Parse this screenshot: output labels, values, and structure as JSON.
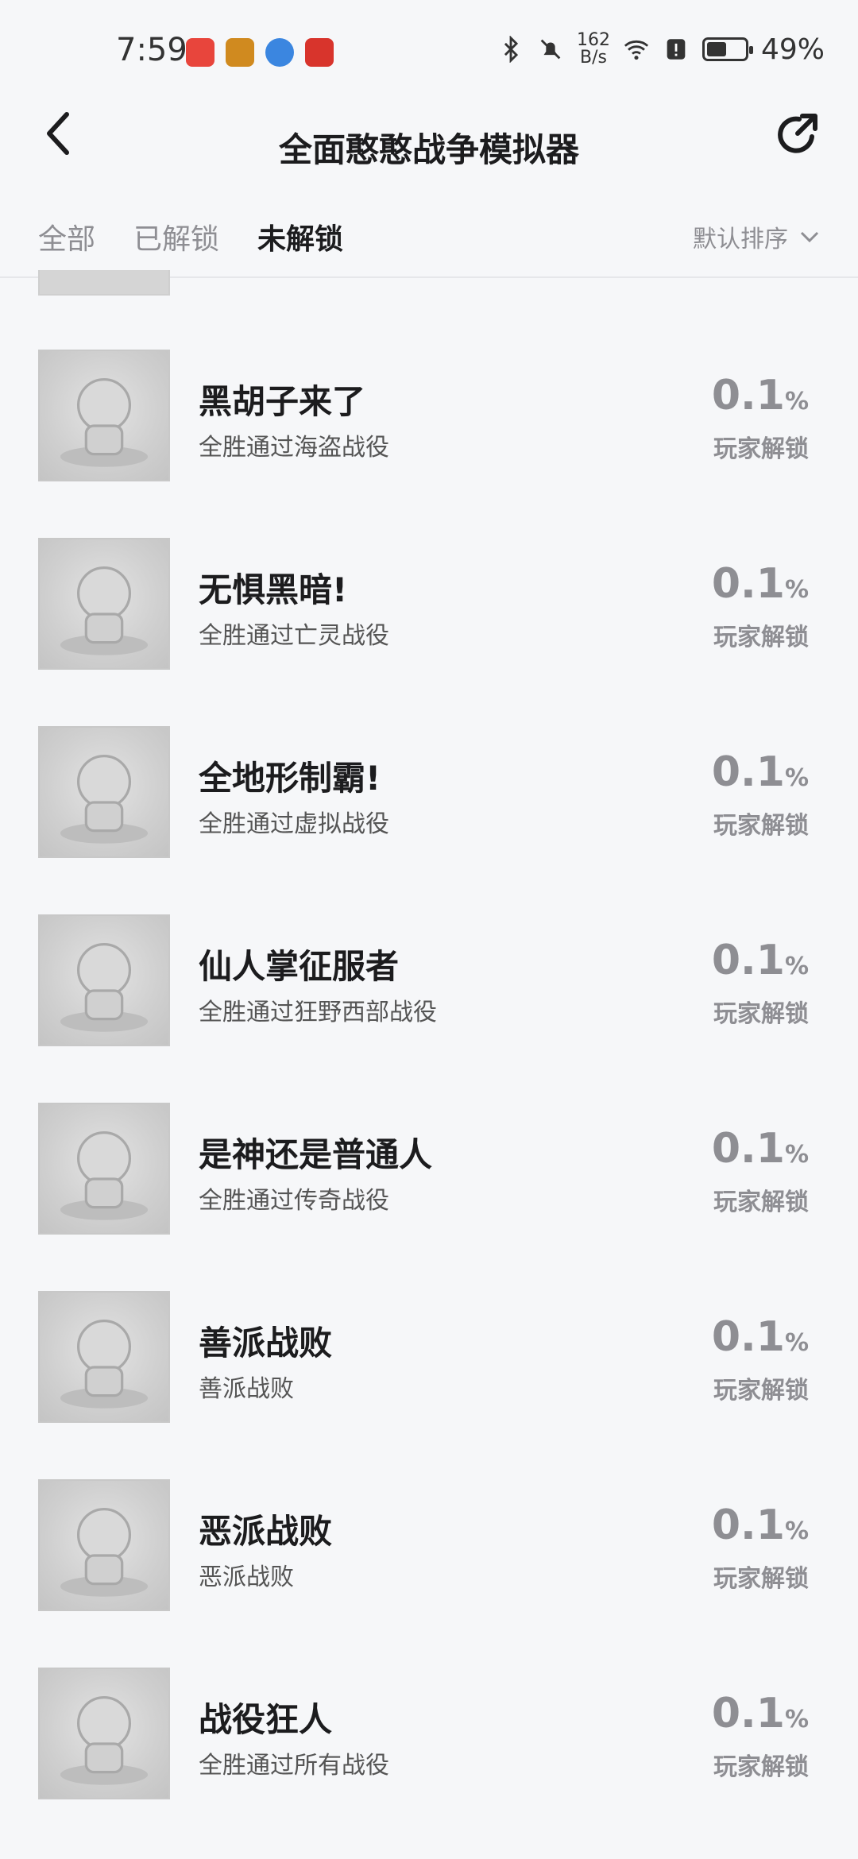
{
  "status": {
    "time": "7:59",
    "net_speed": "162\nB/s",
    "net_speed_value": "162",
    "net_speed_unit": "B/s",
    "battery": "49%"
  },
  "header": {
    "title": "全面憨憨战争模拟器"
  },
  "tabs": [
    {
      "label": "全部"
    },
    {
      "label": "已解锁"
    },
    {
      "label": "未解锁"
    }
  ],
  "sort": {
    "label": "默认排序"
  },
  "achievements": [
    {
      "title": "黑胡子来了",
      "desc": "全胜通过海盗战役",
      "percent": "0.1",
      "unit": "%",
      "label": "玩家解锁"
    },
    {
      "title": "无惧黑暗!",
      "desc": "全胜通过亡灵战役",
      "percent": "0.1",
      "unit": "%",
      "label": "玩家解锁"
    },
    {
      "title": "全地形制霸!",
      "desc": "全胜通过虚拟战役",
      "percent": "0.1",
      "unit": "%",
      "label": "玩家解锁"
    },
    {
      "title": "仙人掌征服者",
      "desc": "全胜通过狂野西部战役",
      "percent": "0.1",
      "unit": "%",
      "label": "玩家解锁"
    },
    {
      "title": "是神还是普通人",
      "desc": "全胜通过传奇战役",
      "percent": "0.1",
      "unit": "%",
      "label": "玩家解锁"
    },
    {
      "title": "善派战败",
      "desc": "善派战败",
      "percent": "0.1",
      "unit": "%",
      "label": "玩家解锁"
    },
    {
      "title": "恶派战败",
      "desc": "恶派战败",
      "percent": "0.1",
      "unit": "%",
      "label": "玩家解锁"
    },
    {
      "title": "战役狂人",
      "desc": "全胜通过所有战役",
      "percent": "0.1",
      "unit": "%",
      "label": "玩家解锁"
    }
  ],
  "colors": {
    "background": "#f6f7f9",
    "title_text": "#1c1c1e",
    "muted_text": "#8e8e93"
  }
}
